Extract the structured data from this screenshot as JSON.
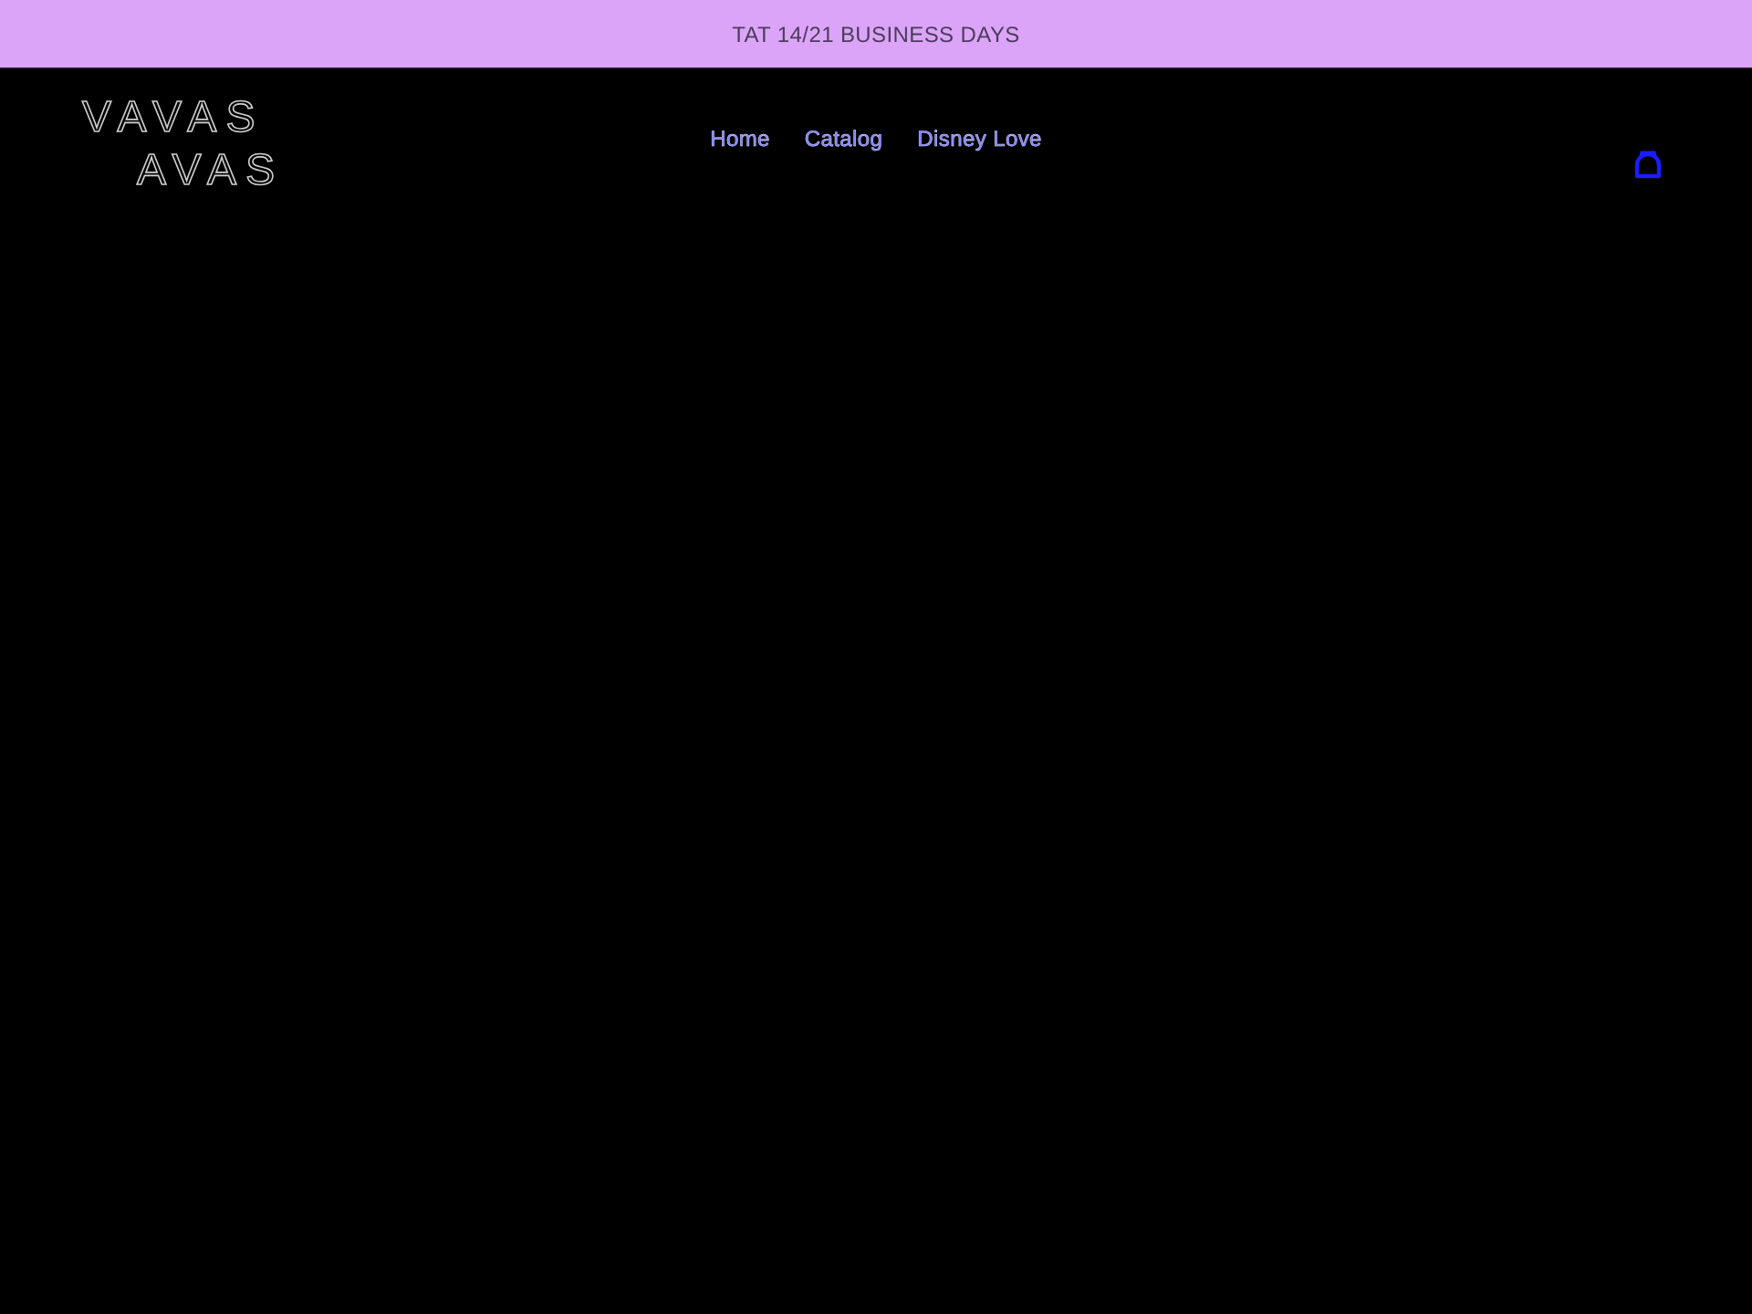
{
  "announcement_bar": {
    "text": "TAT 14/21 BUSINESS DAYS"
  },
  "header": {
    "logo": {
      "lines": [
        "VAVAS",
        "AVAS"
      ]
    },
    "nav": [
      {
        "label": "Home"
      },
      {
        "label": "Catalog"
      },
      {
        "label": "Disney Love"
      }
    ]
  }
}
